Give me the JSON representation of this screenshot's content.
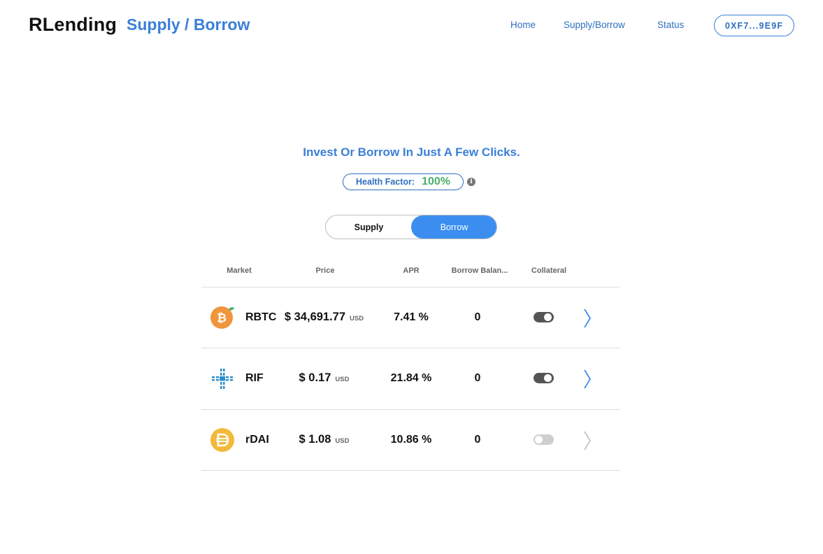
{
  "header": {
    "brand": "RLending",
    "page_title": "Supply / Borrow",
    "nav": {
      "home": "Home",
      "supply_borrow": "Supply/Borrow",
      "status": "Status"
    },
    "wallet": "0XF7...9E9F"
  },
  "tagline": "Invest Or Borrow In Just A Few Clicks.",
  "health": {
    "label": "Health Factor:",
    "value": "100%"
  },
  "mode_toggle": {
    "supply": "Supply",
    "borrow": "Borrow",
    "active": "Borrow"
  },
  "table": {
    "headers": {
      "market": "Market",
      "price": "Price",
      "apr": "APR",
      "balance": "Borrow Balan...",
      "collateral": "Collateral"
    },
    "rows": [
      {
        "market": "RBTC",
        "price": "$ 34,691.77",
        "unit": "USD",
        "apr": "7.41 %",
        "balance": "0",
        "collateral": true
      },
      {
        "market": "RIF",
        "price": "$ 0.17",
        "unit": "USD",
        "apr": "21.84 %",
        "balance": "0",
        "collateral": true
      },
      {
        "market": "rDAI",
        "price": "$ 1.08",
        "unit": "USD",
        "apr": "10.86 %",
        "balance": "0",
        "collateral": false
      }
    ]
  },
  "icons": {
    "rbtc": "rbtc-coin-icon",
    "rif": "rif-coin-icon",
    "rdai": "rdai-coin-icon",
    "info": "info-icon",
    "chevron": "chevron-right-icon"
  },
  "colors": {
    "accent": "#3a7fd8",
    "accent_dark": "#2e6fbf",
    "borrow_active": "#3b8ef0",
    "health_green": "#4cae6c",
    "rbtc_orange": "#f0953a",
    "rif_blue": "#2b8fc9",
    "rdai_yellow": "#f2b93a"
  }
}
